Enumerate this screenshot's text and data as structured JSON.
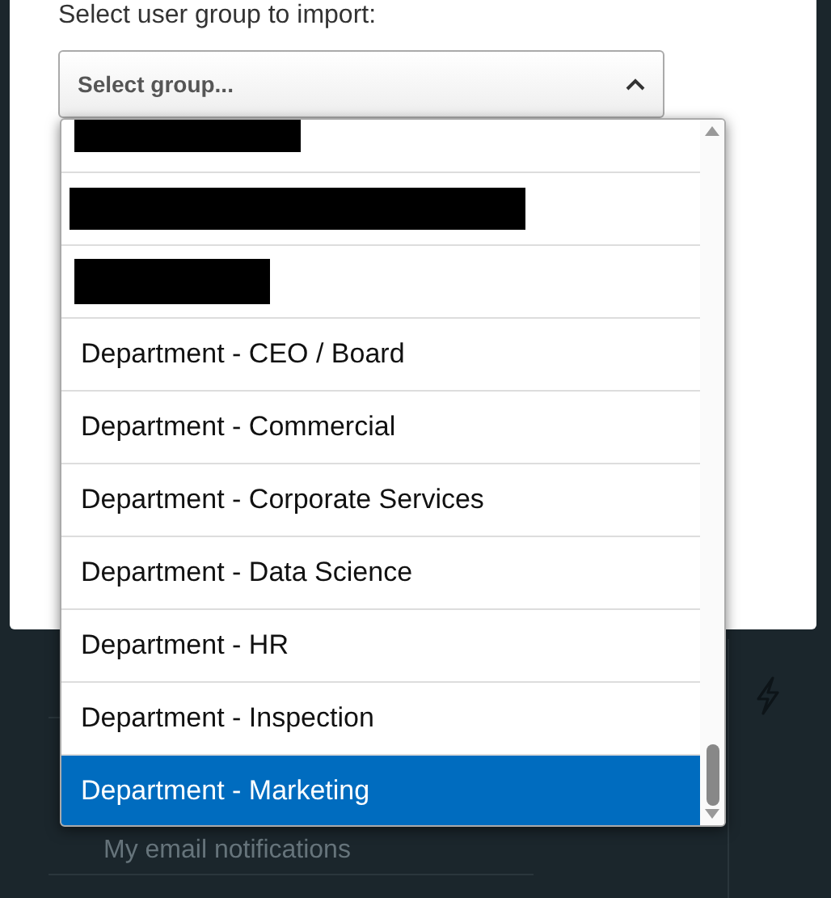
{
  "dialog": {
    "label": "Select user group to import:",
    "select": {
      "placeholder": "Select group...",
      "expanded": true
    }
  },
  "dropdown": {
    "options": [
      {
        "kind": "redacted",
        "selected": false
      },
      {
        "kind": "redacted",
        "selected": false
      },
      {
        "kind": "redacted",
        "selected": false
      },
      {
        "kind": "option",
        "label": "Department - CEO / Board",
        "selected": false
      },
      {
        "kind": "option",
        "label": "Department - Commercial",
        "selected": false
      },
      {
        "kind": "option",
        "label": "Department - Corporate Services",
        "selected": false
      },
      {
        "kind": "option",
        "label": "Department - Data Science",
        "selected": false
      },
      {
        "kind": "option",
        "label": "Department - HR",
        "selected": false
      },
      {
        "kind": "option",
        "label": "Department - Inspection",
        "selected": false
      },
      {
        "kind": "option",
        "label": "Department - Marketing",
        "selected": true
      }
    ]
  },
  "background": {
    "menu_item": "My email notifications"
  }
}
